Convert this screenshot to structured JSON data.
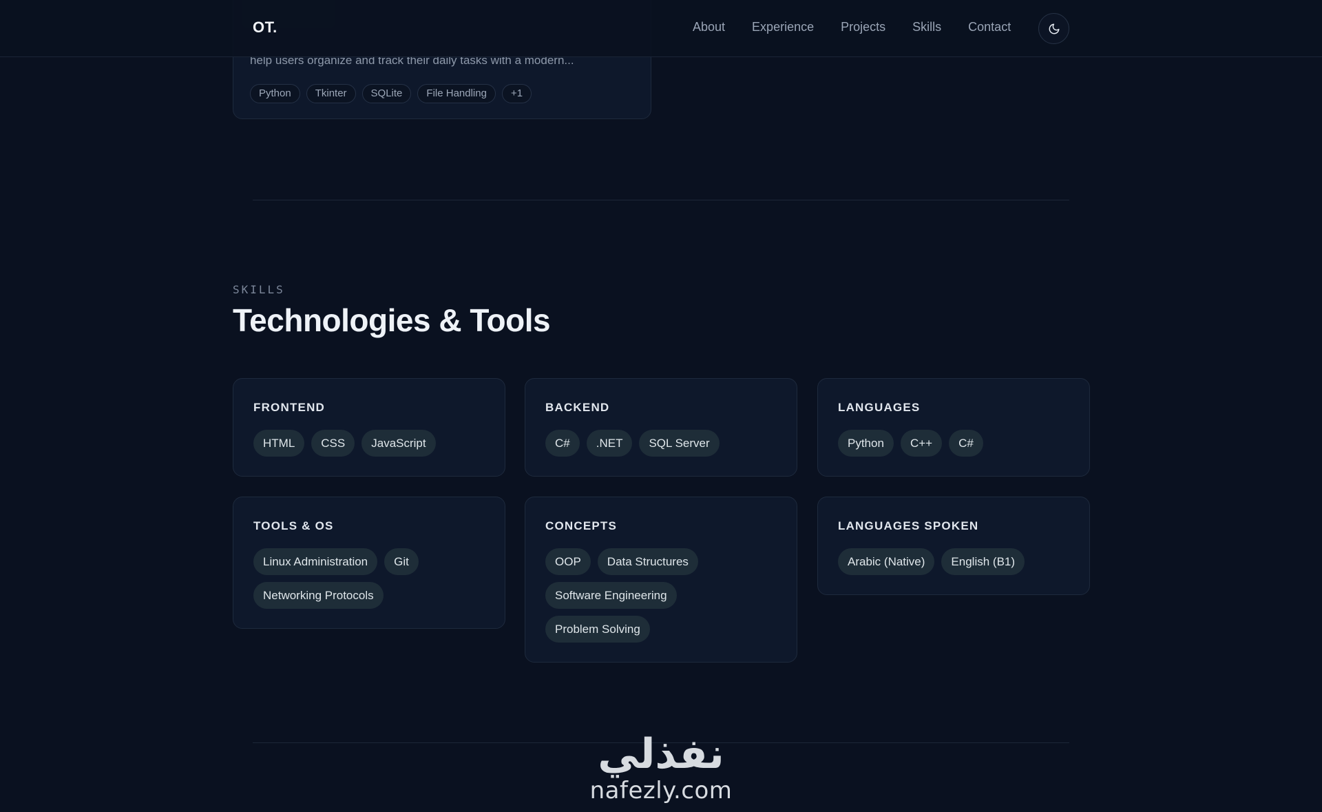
{
  "nav": {
    "logo": "OT.",
    "links": [
      "About",
      "Experience",
      "Projects",
      "Skills",
      "Contact"
    ],
    "theme_icon": "moon-icon"
  },
  "project_card": {
    "description": "help users organize and track their daily tasks with a modern...",
    "tags": [
      "Python",
      "Tkinter",
      "SQLite",
      "File Handling",
      "+1"
    ]
  },
  "skills": {
    "eyebrow": "SKILLS",
    "title": "Technologies & Tools",
    "cards": [
      {
        "title": "FRONTEND",
        "items": [
          "HTML",
          "CSS",
          "JavaScript"
        ]
      },
      {
        "title": "BACKEND",
        "items": [
          "C#",
          ".NET",
          "SQL Server"
        ]
      },
      {
        "title": "LANGUAGES",
        "items": [
          "Python",
          "C++",
          "C#"
        ]
      },
      {
        "title": "TOOLS & OS",
        "items": [
          "Linux Administration",
          "Git",
          "Networking Protocols"
        ]
      },
      {
        "title": "CONCEPTS",
        "items": [
          "OOP",
          "Data Structures",
          "Software Engineering",
          "Problem Solving"
        ]
      },
      {
        "title": "LANGUAGES SPOKEN",
        "items": [
          "Arabic (Native)",
          "English (B1)"
        ]
      }
    ]
  },
  "watermark": {
    "arabic": "نفذلي",
    "latin": "nafezly.com"
  },
  "colors": {
    "background": "#0a1120",
    "card": "#0e182b",
    "chip": "#1e2d38",
    "heading": "#eef2f7",
    "muted": "#8e99aa"
  }
}
